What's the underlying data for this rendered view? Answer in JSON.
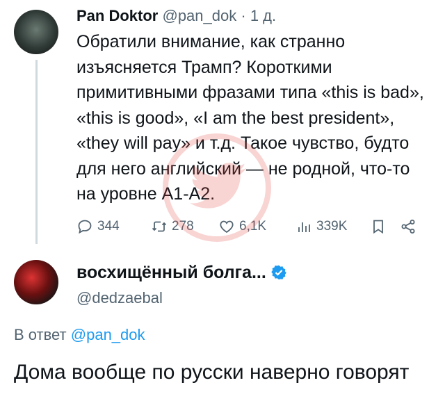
{
  "tweet": {
    "author_name": "Pan Doktor",
    "handle": "@pan_dok",
    "separator": "·",
    "time": "1 д.",
    "text": "Обратили внимание, как странно изъясняется Трамп? Короткими примитивными фразами типа «this is bad», «this is good», «I am the best president», «they will pay» и т.д. Такое чувство, будто для него английский — не родной, что-то на уровне А1-А2.",
    "replies": "344",
    "retweets": "278",
    "likes": "6,1K",
    "views": "339K"
  },
  "reply": {
    "author_name": "восхищённый болга...",
    "handle": "@dedzaebal",
    "reply_label": "В ответ",
    "reply_mention": "@pan_dok",
    "text": "Дома вообще по русски наверно говорят"
  },
  "colors": {
    "accent": "#1d9bf0",
    "muted": "#536471",
    "text": "#0f1419",
    "watermark": "#e0403a"
  },
  "icons": [
    "reply-icon",
    "retweet-icon",
    "like-icon",
    "views-icon",
    "bookmark-icon",
    "share-icon",
    "verified-icon",
    "watermark-logo-icon"
  ]
}
